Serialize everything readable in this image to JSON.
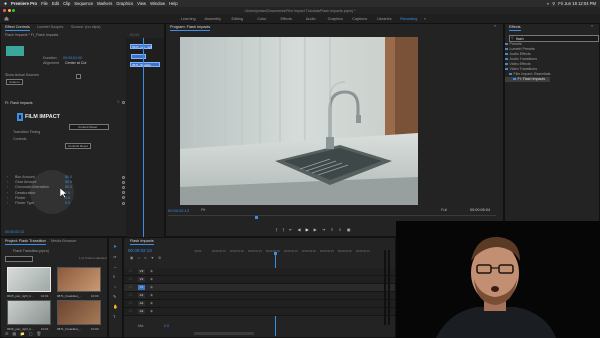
{
  "menubar": {
    "app": "Premiere Pro",
    "items": [
      "File",
      "Edit",
      "Clip",
      "Sequence",
      "Markers",
      "Graphics",
      "View",
      "Window",
      "Help"
    ],
    "datetime": "Fri Jun 18 12:04 PM"
  },
  "titlebar": {
    "text": "/Users/jordan/Documents/Film Impact Tutorials/Flash Impacts.prproj *"
  },
  "workspaces": {
    "items": [
      "Learning",
      "Assembly",
      "Editing",
      "Color",
      "Effects",
      "Audio",
      "Graphics",
      "Captions",
      "Libraries",
      "Recording",
      "»"
    ],
    "active_index": 9
  },
  "effect_controls": {
    "tabs": [
      "Effect Controls",
      "Lumetri Scopes",
      "Source: (no clips)"
    ],
    "source_line": "Source • FI_Flash Impacts",
    "clip_line": "Flash Impacts * FI_Flash Impacts",
    "mini_clip_a": "9625_pan_righ",
    "mini_clip_b": "9871_Breakfa",
    "duration_label": "Duration",
    "duration_value": "00:00:01:00",
    "alignment_label": "Alignment",
    "alignment_value": "Center at Cut",
    "show_sources_label": "Show Actual Sources",
    "custom_button": "Custom...",
    "effect_name": "FI: Flash Impacts",
    "logo_text": "FILM IMPACT",
    "reset_button": "Content Reset",
    "transition_timing": "Transition Timing",
    "controls_label": "Controls",
    "controls_button": "Controls Reset",
    "params": [
      {
        "label": "Blur Amount",
        "value": "50.0"
      },
      {
        "label": "Glow Amount",
        "value": "50.0"
      },
      {
        "label": "Chromatic Aberration",
        "value": "50.0"
      },
      {
        "label": "Desaturation",
        "value": "0.0"
      },
      {
        "label": "Flicker",
        "value": "0.0"
      },
      {
        "label": "Flicker Type",
        "value": "0.0"
      }
    ],
    "timecode": "00:00:02:13"
  },
  "program": {
    "tab": "Program: Flash Impacts",
    "timecode": "00:00:02:13",
    "fit": "Fit",
    "quality": "Full",
    "duration": "00:00:05:04"
  },
  "effects": {
    "tab": "Effects",
    "search": "flash",
    "tree": [
      "Presets",
      "Lumetri Presets",
      "Audio Effects",
      "Audio Transitions",
      "Video Effects",
      "Video Transitions",
      "Film Impact: Essentials",
      "FI: Flash Impacts"
    ]
  },
  "project": {
    "tabs": [
      "Project: Flash Transition",
      "Media Browser"
    ],
    "bin": "Flash Transition.prproj",
    "item_count": "1 of 3 items selected",
    "items": [
      {
        "name": "9625_pan_right_b...",
        "dur": "10:01"
      },
      {
        "name": "9871_breakfast_...",
        "dur": "10:00"
      },
      {
        "name": "9625_pan_right_b...",
        "dur": "10:01"
      },
      {
        "name": "9871_breakfast_...",
        "dur": "10:00"
      }
    ]
  },
  "timeline": {
    "tab": "Flash Impacts",
    "timecode": "00:00:02:13",
    "ruler": [
      ":00:00",
      "00:00:00:15",
      "00:00:01:00",
      "00:00:01:15",
      "00:00:02:00",
      "00:00:02:15",
      "00:00:03:00",
      "00:00:03:15",
      "00:00:04:00",
      "00:00:04:15"
    ],
    "video_tracks": [
      "V3",
      "V2",
      "V1"
    ],
    "audio_tracks": [
      "A1",
      "A2",
      "A3"
    ],
    "clip_a": "9625_pan_right_sdk",
    "transition": "Flash Impacts",
    "clip_b": "9871_Breakfa",
    "mix": "Mix",
    "mix_value": "0.0"
  },
  "colors": {
    "accent": "#3a8ee6",
    "clip": "#3b74c9",
    "panel": "#232323",
    "background": "#1b1b1b"
  }
}
